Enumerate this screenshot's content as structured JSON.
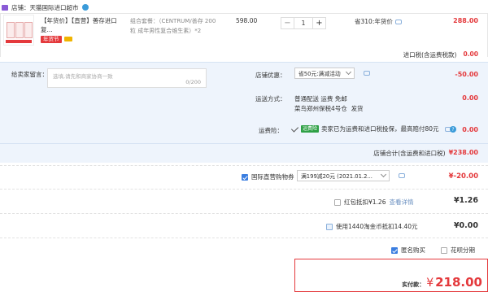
{
  "shop": {
    "label": "店铺：天猫国际进口超市"
  },
  "item": {
    "tag": "【年货价】",
    "title": "【直营】善存进口复...",
    "badge": "年货节",
    "options": "组合套餐：（CENTRUM/善存 200粒 成年男性复合维生素）*2",
    "unit_price": "598.00",
    "quantity": "1",
    "discount": "省310:年货价",
    "subtotal": "288.00"
  },
  "import_tax": {
    "label": "进口税(含运费税款)",
    "value": "0.00"
  },
  "message": {
    "label": "给卖家留言：",
    "placeholder": "选填,请先和商家协商一致",
    "counter": "0/200"
  },
  "shop_promo": {
    "label": "店铺优惠：",
    "selected": "省50元:满减活动",
    "value": "-50.00"
  },
  "shipping": {
    "label": "运送方式：",
    "line1": "普通配送 运费 免邮",
    "line2": "菜鸟郑州保税4号仓",
    "line3": "发货",
    "value": "0.00"
  },
  "insurance": {
    "label": "运费险：",
    "badge": "运费险",
    "text": "卖家已为运费和进口税投保，最高赔付80元",
    "value": "0.00"
  },
  "shop_total": {
    "label": "店铺合计(含运费和进口税)",
    "value": "¥238.00"
  },
  "coupon": {
    "label": "国际直营购物券",
    "selected": "满199减20元 (2021.01.2...",
    "value": "¥-20.00"
  },
  "redpacket": {
    "label": "红包抵扣¥1.26",
    "link": "查看详情",
    "value": "¥1.26"
  },
  "taobao_coin": {
    "label": "使用1440淘金币抵扣14.40元",
    "value": "¥0.00"
  },
  "anonymous": {
    "label": "匿名购买"
  },
  "huabei": {
    "label": "花呗分期"
  },
  "pay": {
    "label": "实付款：",
    "currency": "¥",
    "amount": "218.00"
  },
  "colors": {
    "accent": "#e4393c",
    "panel": "#eef4fc",
    "check": "#3b7ee0"
  }
}
